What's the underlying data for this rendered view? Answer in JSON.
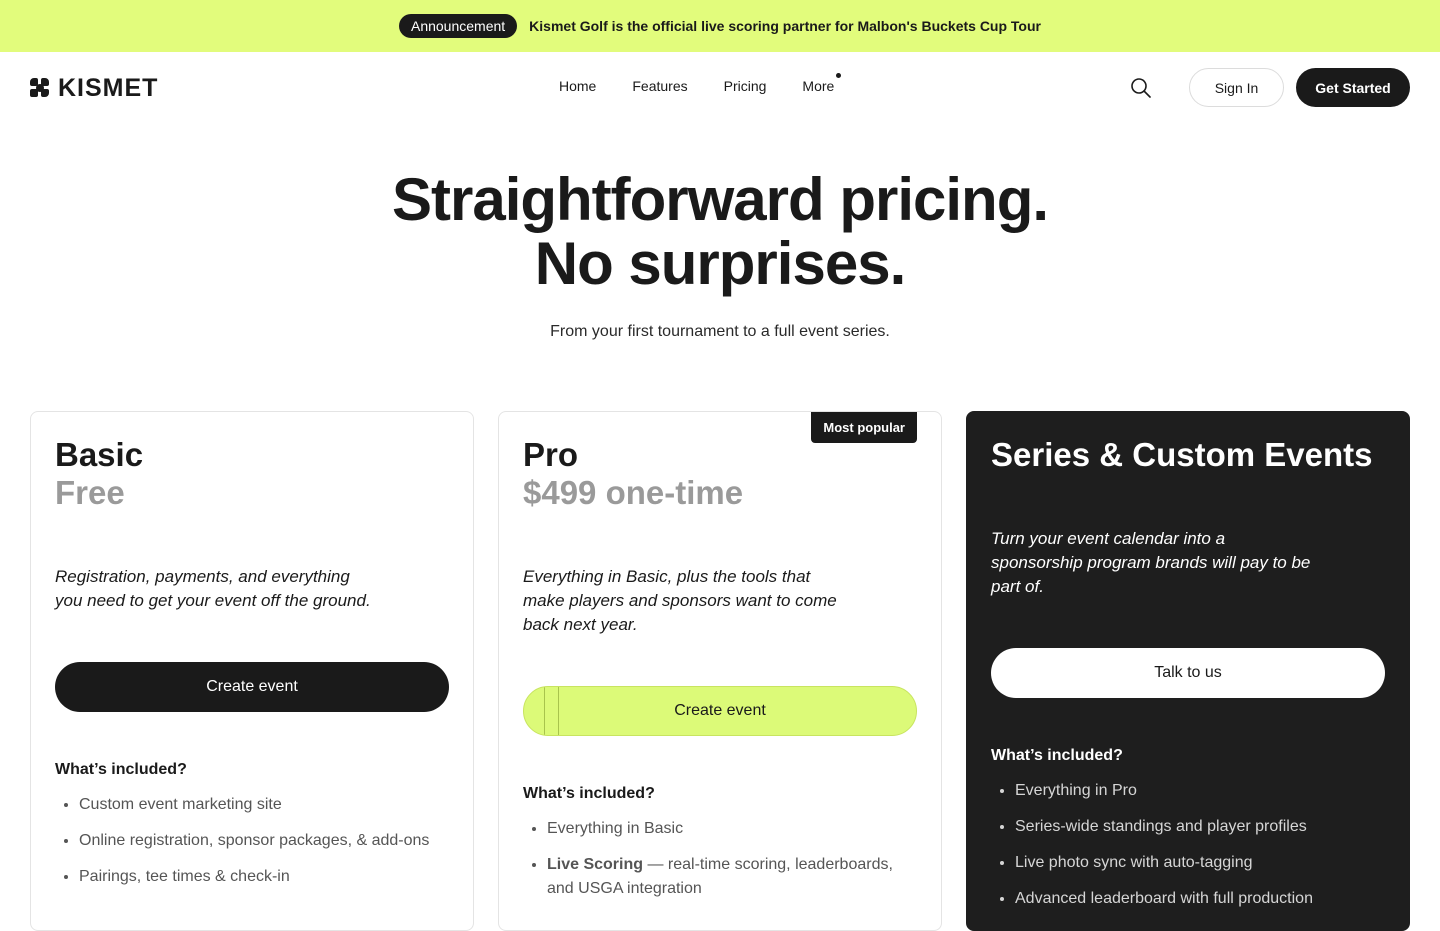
{
  "announcement": {
    "pill": "Announcement",
    "message": "Kismet Golf is the official live scoring partner for Malbon's Buckets Cup Tour"
  },
  "brand": {
    "name": "KISMET",
    "accent": "#e2fc7c",
    "dark": "#1a1a1a"
  },
  "nav": {
    "items": [
      "Home",
      "Features",
      "Pricing",
      "More"
    ],
    "search_icon": "search-icon",
    "sign_in": "Sign In",
    "get_started": "Get Started"
  },
  "hero": {
    "title_line1": "Straightforward pricing.",
    "title_line2": "No surprises.",
    "subtitle": "From your first tournament to a full event series."
  },
  "plans": [
    {
      "name": "Basic",
      "price": "Free",
      "description_line1": "Registration, payments, and everything",
      "description_line2": "you need to get your event off the ground.",
      "cta": "Create event",
      "included_heading": "What’s included?",
      "features": [
        "Custom event marketing site",
        "Online registration, sponsor packages, & add-ons",
        "Pairings, tee times & check-in"
      ]
    },
    {
      "name": "Pro",
      "badge": "Most popular",
      "price": "$499 one-time",
      "description_line1": "Everything in Basic, plus the tools that",
      "description_line2": "make players and sponsors want to come",
      "description_line3": "back next year.",
      "cta": "Create event",
      "included_heading": "What’s included?",
      "features": [
        {
          "text": "Everything in Basic"
        },
        {
          "bold": "Live Scoring",
          "text": " — real-time scoring, leaderboards, and USGA integration"
        }
      ]
    },
    {
      "name": "Series & Custom Events",
      "description_line1": "Turn your event calendar into a",
      "description_line2": "sponsorship program brands will pay to be",
      "description_line3": "part of.",
      "cta": "Talk to us",
      "included_heading": "What’s included?",
      "features": [
        "Everything in Pro",
        "Series-wide standings and player profiles",
        "Live photo sync with auto-tagging",
        "Advanced leaderboard with full production"
      ]
    }
  ]
}
